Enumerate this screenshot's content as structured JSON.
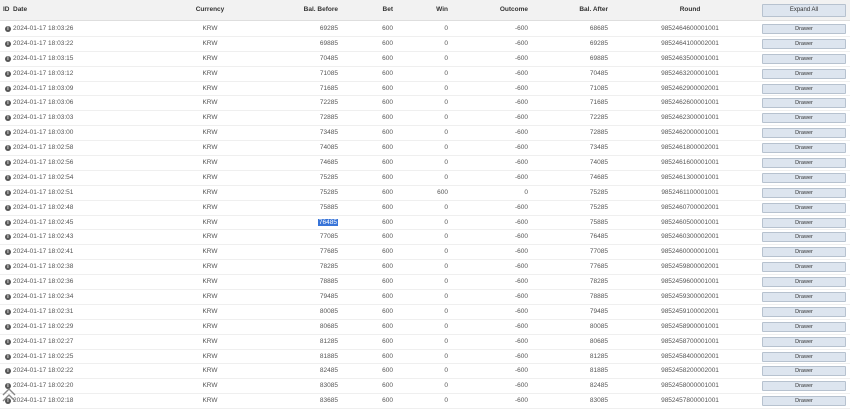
{
  "header": {
    "id": "ID",
    "date": "Date",
    "currency": "Currency",
    "bal_before": "Bal. Before",
    "bet": "Bet",
    "win": "Win",
    "outcome": "Outcome",
    "bal_after": "Bal. After",
    "round": "Round",
    "expand_all": "Expand All"
  },
  "drawer_label": "Drawer",
  "info_glyph": "i",
  "selected_text": "76485",
  "colors": {
    "selection": "#3874d8",
    "button_bg": "#dde5ef",
    "header_bg": "#f2f2f2"
  },
  "icons": {
    "row_info": "info-icon",
    "scroll_to_top": "double-chevron-up-icon"
  },
  "rows": [
    {
      "date": "2024-01-17 18:03:26",
      "currency": "KRW",
      "bal_before": "69285",
      "bet": "600",
      "win": "0",
      "outcome": "-600",
      "bal_after": "68685",
      "round": "9852464600001001"
    },
    {
      "date": "2024-01-17 18:03:22",
      "currency": "KRW",
      "bal_before": "69885",
      "bet": "600",
      "win": "0",
      "outcome": "-600",
      "bal_after": "69285",
      "round": "9852464100002001"
    },
    {
      "date": "2024-01-17 18:03:15",
      "currency": "KRW",
      "bal_before": "70485",
      "bet": "600",
      "win": "0",
      "outcome": "-600",
      "bal_after": "69885",
      "round": "9852463500001001"
    },
    {
      "date": "2024-01-17 18:03:12",
      "currency": "KRW",
      "bal_before": "71085",
      "bet": "600",
      "win": "0",
      "outcome": "-600",
      "bal_after": "70485",
      "round": "9852463200001001"
    },
    {
      "date": "2024-01-17 18:03:09",
      "currency": "KRW",
      "bal_before": "71685",
      "bet": "600",
      "win": "0",
      "outcome": "-600",
      "bal_after": "71085",
      "round": "9852462900002001"
    },
    {
      "date": "2024-01-17 18:03:06",
      "currency": "KRW",
      "bal_before": "72285",
      "bet": "600",
      "win": "0",
      "outcome": "-600",
      "bal_after": "71685",
      "round": "9852462600001001"
    },
    {
      "date": "2024-01-17 18:03:03",
      "currency": "KRW",
      "bal_before": "72885",
      "bet": "600",
      "win": "0",
      "outcome": "-600",
      "bal_after": "72285",
      "round": "9852462300001001"
    },
    {
      "date": "2024-01-17 18:03:00",
      "currency": "KRW",
      "bal_before": "73485",
      "bet": "600",
      "win": "0",
      "outcome": "-600",
      "bal_after": "72885",
      "round": "9852462000001001"
    },
    {
      "date": "2024-01-17 18:02:58",
      "currency": "KRW",
      "bal_before": "74085",
      "bet": "600",
      "win": "0",
      "outcome": "-600",
      "bal_after": "73485",
      "round": "9852461800002001"
    },
    {
      "date": "2024-01-17 18:02:56",
      "currency": "KRW",
      "bal_before": "74685",
      "bet": "600",
      "win": "0",
      "outcome": "-600",
      "bal_after": "74085",
      "round": "9852461600001001"
    },
    {
      "date": "2024-01-17 18:02:54",
      "currency": "KRW",
      "bal_before": "75285",
      "bet": "600",
      "win": "0",
      "outcome": "-600",
      "bal_after": "74685",
      "round": "9852461300001001"
    },
    {
      "date": "2024-01-17 18:02:51",
      "currency": "KRW",
      "bal_before": "75285",
      "bet": "600",
      "win": "600",
      "outcome": "0",
      "bal_after": "75285",
      "round": "9852461100001001"
    },
    {
      "date": "2024-01-17 18:02:48",
      "currency": "KRW",
      "bal_before": "75885",
      "bet": "600",
      "win": "0",
      "outcome": "-600",
      "bal_after": "75285",
      "round": "9852460700002001"
    },
    {
      "date": "2024-01-17 18:02:45",
      "currency": "KRW",
      "bal_before": "76485",
      "bet": "600",
      "win": "0",
      "outcome": "-600",
      "bal_after": "75885",
      "round": "9852460500001001",
      "selected": true
    },
    {
      "date": "2024-01-17 18:02:43",
      "currency": "KRW",
      "bal_before": "77085",
      "bet": "600",
      "win": "0",
      "outcome": "-600",
      "bal_after": "76485",
      "round": "9852460300002001"
    },
    {
      "date": "2024-01-17 18:02:41",
      "currency": "KRW",
      "bal_before": "77685",
      "bet": "600",
      "win": "0",
      "outcome": "-600",
      "bal_after": "77085",
      "round": "9852460000001001"
    },
    {
      "date": "2024-01-17 18:02:38",
      "currency": "KRW",
      "bal_before": "78285",
      "bet": "600",
      "win": "0",
      "outcome": "-600",
      "bal_after": "77685",
      "round": "9852459800002001"
    },
    {
      "date": "2024-01-17 18:02:36",
      "currency": "KRW",
      "bal_before": "78885",
      "bet": "600",
      "win": "0",
      "outcome": "-600",
      "bal_after": "78285",
      "round": "9852459600001001"
    },
    {
      "date": "2024-01-17 18:02:34",
      "currency": "KRW",
      "bal_before": "79485",
      "bet": "600",
      "win": "0",
      "outcome": "-600",
      "bal_after": "78885",
      "round": "9852459300002001"
    },
    {
      "date": "2024-01-17 18:02:31",
      "currency": "KRW",
      "bal_before": "80085",
      "bet": "600",
      "win": "0",
      "outcome": "-600",
      "bal_after": "79485",
      "round": "9852459100002001"
    },
    {
      "date": "2024-01-17 18:02:29",
      "currency": "KRW",
      "bal_before": "80685",
      "bet": "600",
      "win": "0",
      "outcome": "-600",
      "bal_after": "80085",
      "round": "9852458900001001"
    },
    {
      "date": "2024-01-17 18:02:27",
      "currency": "KRW",
      "bal_before": "81285",
      "bet": "600",
      "win": "0",
      "outcome": "-600",
      "bal_after": "80685",
      "round": "9852458700001001"
    },
    {
      "date": "2024-01-17 18:02:25",
      "currency": "KRW",
      "bal_before": "81885",
      "bet": "600",
      "win": "0",
      "outcome": "-600",
      "bal_after": "81285",
      "round": "9852458400002001"
    },
    {
      "date": "2024-01-17 18:02:22",
      "currency": "KRW",
      "bal_before": "82485",
      "bet": "600",
      "win": "0",
      "outcome": "-600",
      "bal_after": "81885",
      "round": "9852458200002001"
    },
    {
      "date": "2024-01-17 18:02:20",
      "currency": "KRW",
      "bal_before": "83085",
      "bet": "600",
      "win": "0",
      "outcome": "-600",
      "bal_after": "82485",
      "round": "9852458000001001"
    },
    {
      "date": "2024-01-17 18:02:18",
      "currency": "KRW",
      "bal_before": "83685",
      "bet": "600",
      "win": "0",
      "outcome": "-600",
      "bal_after": "83085",
      "round": "9852457800001001"
    }
  ]
}
